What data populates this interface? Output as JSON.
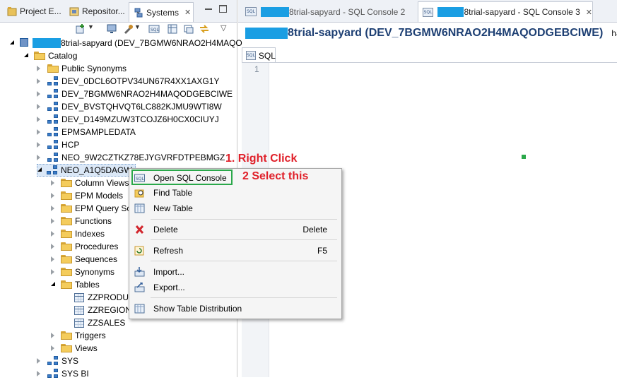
{
  "left_tabs": [
    {
      "label": "Project E...",
      "icon": "project-explorer-icon"
    },
    {
      "label": "Repositor...",
      "icon": "repository-icon"
    },
    {
      "label": "Systems",
      "icon": "systems-icon",
      "active": true
    }
  ],
  "tree": {
    "root": "8trial-sapyard (DEV_7BGMW6NRAO2H4MAQO",
    "catalog": "Catalog",
    "items": [
      "Public Synonyms",
      "DEV_0DCL6OTPV34UN67R4XX1AXG1Y",
      "DEV_7BGMW6NRAO2H4MAQODGEBCIWE",
      "DEV_BVSTQHVQT6LC882KJMU9WTI8W",
      "DEV_D149MZUW3TCOJZ6H0CX0CIUYJ",
      "EPMSAMPLEDATA",
      "HCP",
      "NEO_9W2CZTKZ78EJYGVRFDTPEBMGZ",
      "NEO_A1Q5DAGW"
    ],
    "children": [
      "Column Views",
      "EPM Models",
      "EPM Query So",
      "Functions",
      "Indexes",
      "Procedures",
      "Sequences",
      "Synonyms",
      "Tables"
    ],
    "tables": [
      "ZZPRODUC",
      "ZZREGION",
      "ZZSALES"
    ],
    "after": [
      "Triggers",
      "Views"
    ],
    "bottom": [
      "SYS",
      "SYS BI"
    ]
  },
  "editor_tabs": [
    {
      "label": "8trial-sapyard - SQL Console 2"
    },
    {
      "label": "8trial-sapyard - SQL Console 3",
      "active": true
    }
  ],
  "console_title": "8trial-sapyard (DEV_7BGMW6NRAO2H4MAQODGEBCIWE)",
  "console_title_trail": "ha",
  "sql_tab": "SQL",
  "line_number": "1",
  "context_menu": [
    {
      "label": "Open SQL Console",
      "icon": "sql-console-icon"
    },
    {
      "label": "Find Table",
      "icon": "find-table-icon"
    },
    {
      "label": "New Table",
      "icon": "new-table-icon"
    },
    {
      "label": "Delete",
      "accel": "Delete",
      "icon": "delete-icon"
    },
    {
      "label": "Refresh",
      "accel": "F5",
      "icon": "refresh-icon"
    },
    {
      "label": "Import...",
      "icon": "import-icon"
    },
    {
      "label": "Export...",
      "icon": "export-icon"
    },
    {
      "label": "Show Table Distribution",
      "icon": "table-distribution-icon"
    }
  ],
  "annotations": {
    "step1": "1. Right Click",
    "step2": "2 Select this"
  },
  "colors": {
    "annotation": "#e0202a",
    "highlight": "#2aa84a",
    "redaction": "#1a9ee3",
    "title": "#1d3f73"
  }
}
